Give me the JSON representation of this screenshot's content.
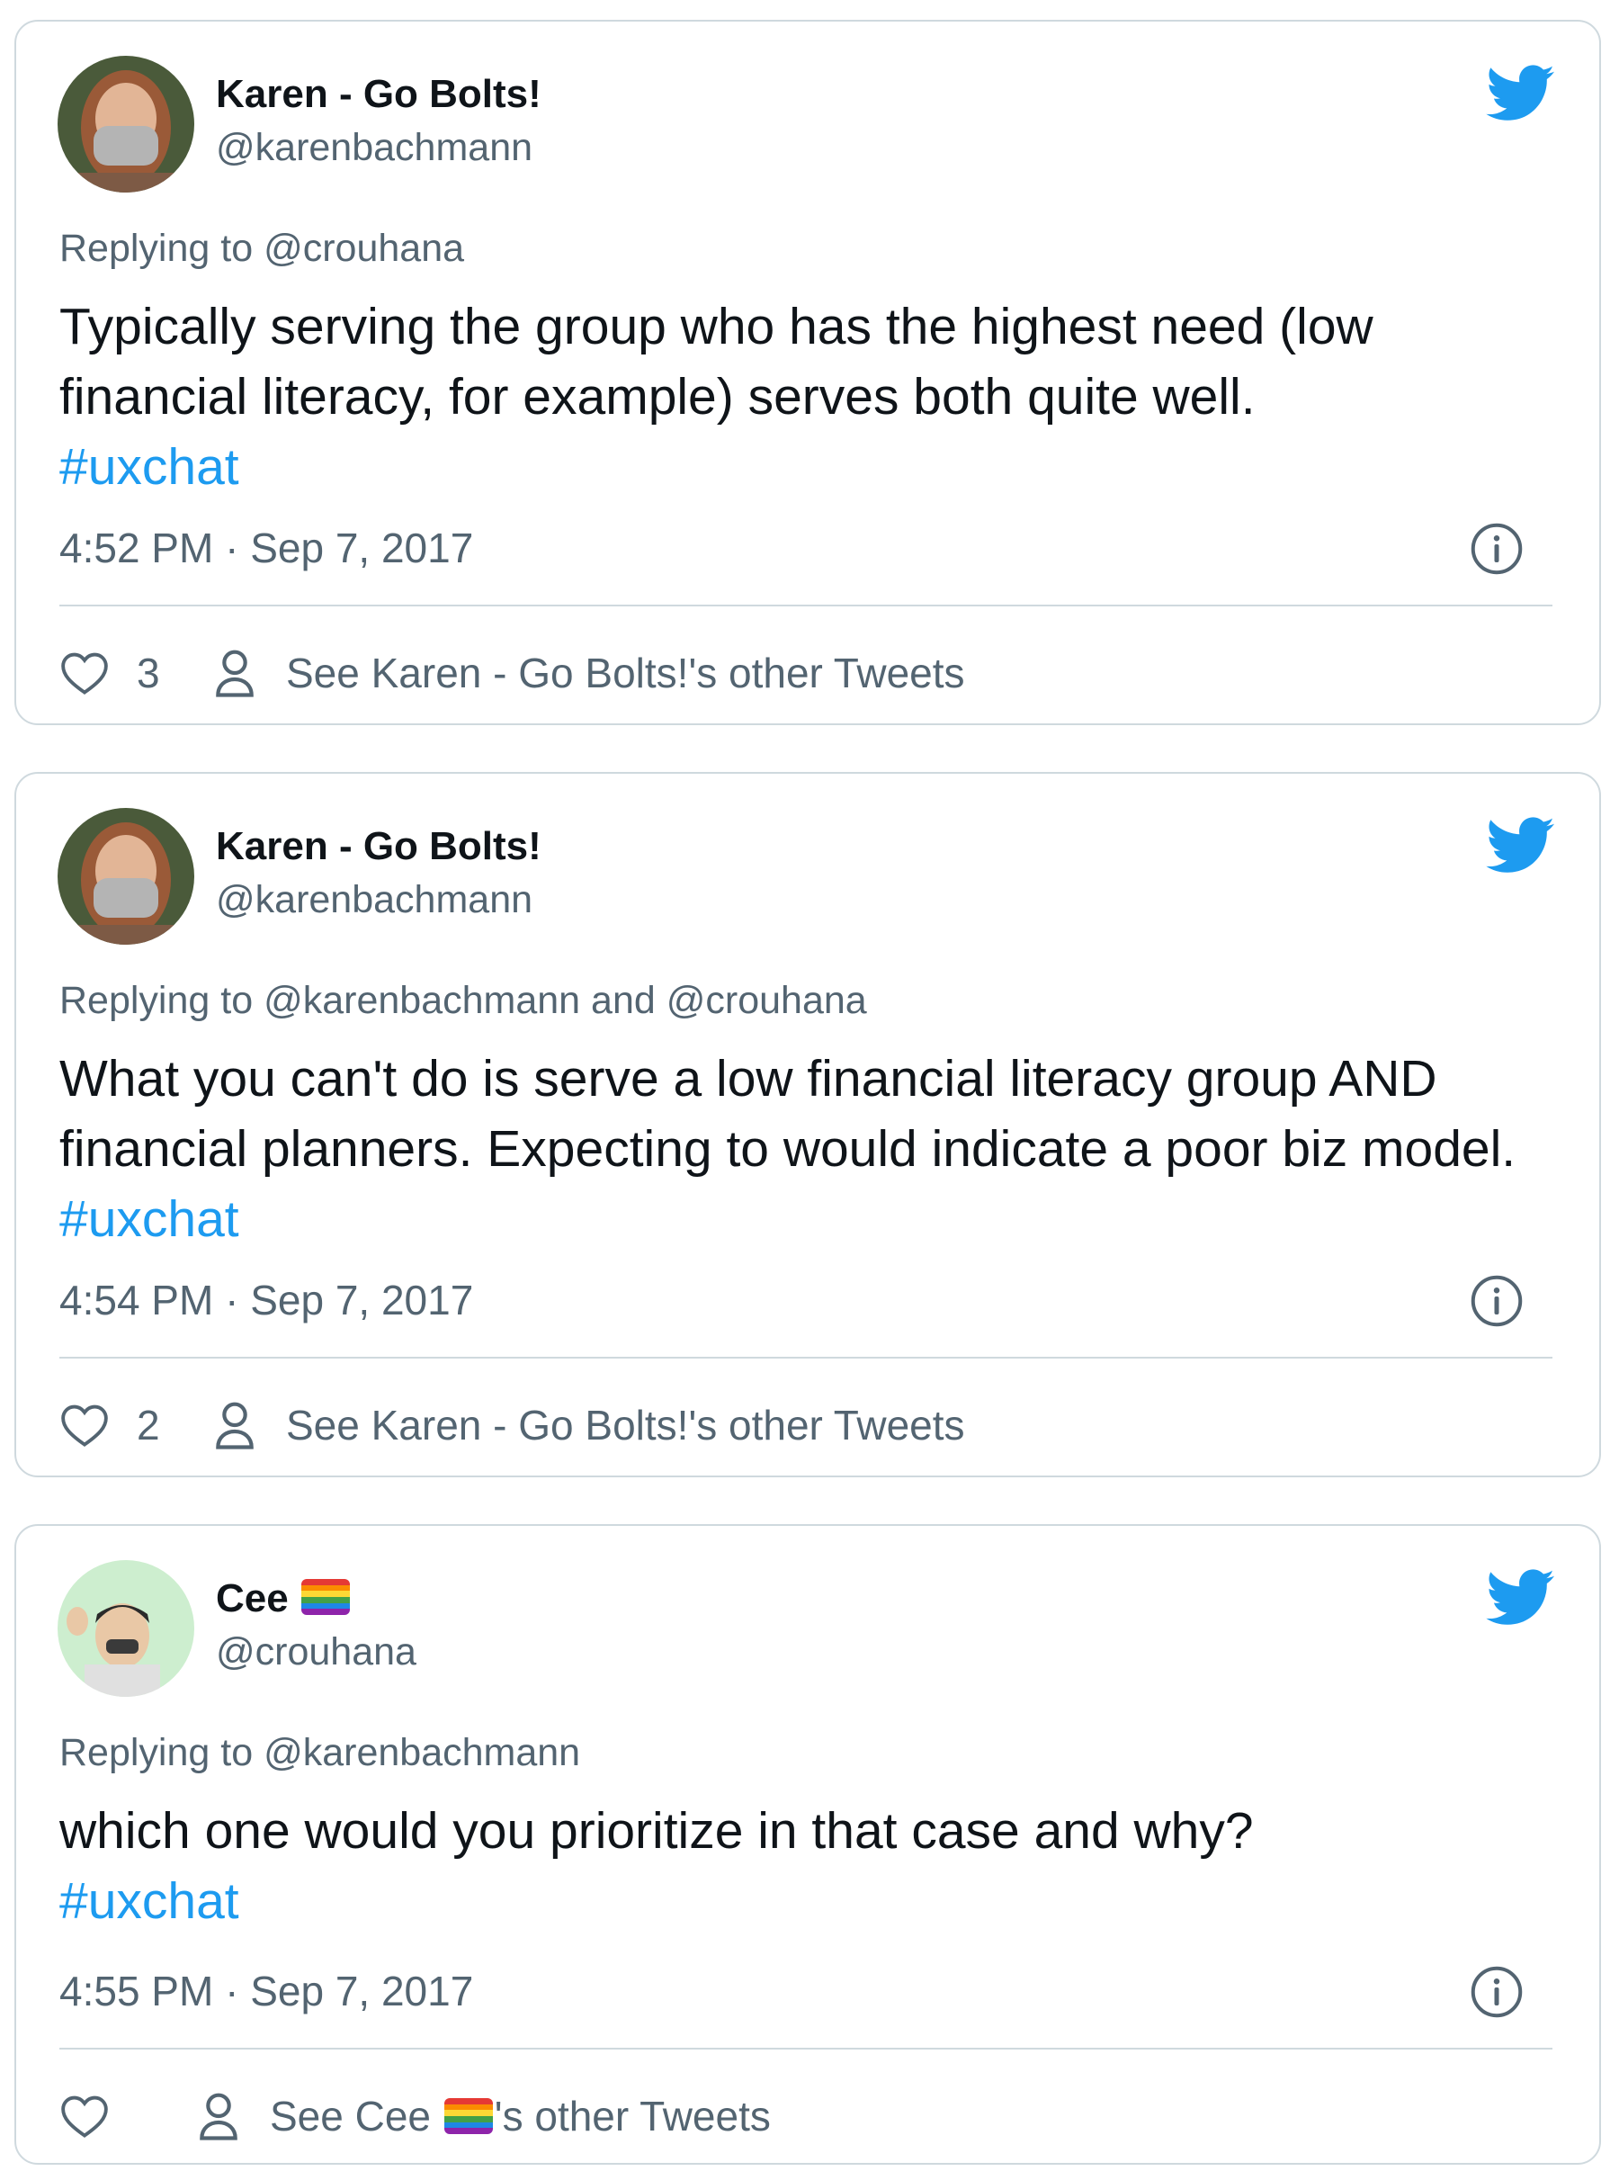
{
  "tweets": [
    {
      "author": "Karen - Go Bolts!",
      "handle": "@karenbachmann",
      "replying_prefix": "Replying to ",
      "replying_to": "@crouhana",
      "text": "Typically serving the group who has the highest need (low financial literacy, for example) serves both quite well.",
      "hashtag": "#uxchat",
      "timestamp": "4:52 PM · Sep 7, 2017",
      "likes": "3",
      "see_more": "See Karen - Go Bolts!'s other Tweets"
    },
    {
      "author": "Karen - Go Bolts!",
      "handle": "@karenbachmann",
      "replying_prefix": "Replying to ",
      "replying_to": "@karenbachmann and @crouhana",
      "text": "What you can't do is serve a low financial literacy group AND financial planners. Expecting to would indicate a poor biz model.",
      "hashtag": "#uxchat",
      "timestamp": "4:54 PM · Sep 7, 2017",
      "likes": "2",
      "see_more": "See Karen - Go Bolts!'s other Tweets"
    },
    {
      "author": "Cee",
      "handle": "@crouhana",
      "replying_prefix": "Replying to ",
      "replying_to": "@karenbachmann",
      "text": "which one would you prioritize in that case and why?",
      "hashtag": "#uxchat",
      "timestamp": "4:55 PM · Sep 7, 2017",
      "likes": "",
      "see_more_prefix": "See Cee",
      "see_more_suffix": "'s other Tweets"
    }
  ],
  "icons": {
    "brand": "twitter-bird-icon",
    "info": "info-icon",
    "like": "heart-icon",
    "profile": "person-icon",
    "flag": "rainbow-flag-emoji"
  },
  "colors": {
    "brand_blue": "#1d9bf0",
    "secondary_text": "#536471",
    "border": "#cfd9de"
  }
}
